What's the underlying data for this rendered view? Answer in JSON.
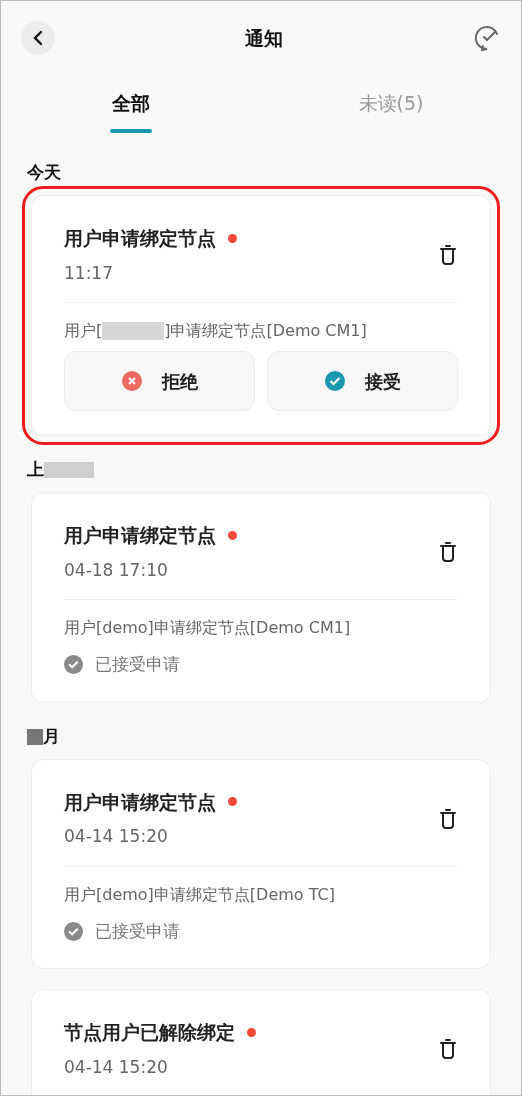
{
  "header": {
    "title": "通知"
  },
  "tabs": [
    {
      "label": "全部",
      "selected": true
    },
    {
      "label": "未读(5)",
      "selected": false
    }
  ],
  "sections": [
    {
      "heading": "今天",
      "heading_redacted": false,
      "cards": [
        {
          "kind": "pending",
          "highlighted": true,
          "title": "用户申请绑定节点",
          "unread": true,
          "time": "11:17",
          "body_before": "用户[",
          "body_redacted": true,
          "body_after": "]申请绑定节点[Demo CM1]",
          "buttons": [
            {
              "kind": "reject",
              "label": "拒绝"
            },
            {
              "kind": "accept",
              "label": "接受"
            }
          ]
        }
      ]
    },
    {
      "heading": "上",
      "heading_redacted": true,
      "cards": [
        {
          "kind": "accepted",
          "highlighted": false,
          "title": "用户申请绑定节点",
          "unread": true,
          "time": "04-18 17:10",
          "body_before": "用户[demo]申请绑定节点[Demo CM1]",
          "body_redacted": false,
          "status": "已接受申请"
        }
      ]
    },
    {
      "heading": "月",
      "heading_redacted": true,
      "cards": [
        {
          "kind": "accepted",
          "highlighted": false,
          "title": "用户申请绑定节点",
          "unread": true,
          "time": "04-14 15:20",
          "body_before": "用户[demo]申请绑定节点[Demo TC]",
          "body_redacted": false,
          "status": "已接受申请"
        },
        {
          "kind": "plain",
          "highlighted": false,
          "title": "节点用户已解除绑定",
          "unread": true,
          "time": "04-14 15:20"
        }
      ]
    }
  ]
}
